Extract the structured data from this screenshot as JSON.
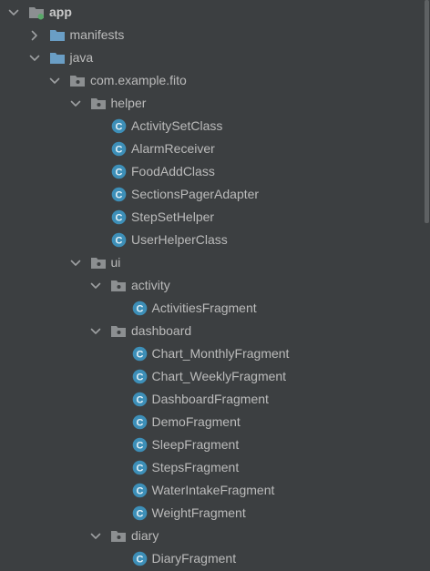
{
  "colors": {
    "background": "#3c3f41",
    "text": "#bbbbbb",
    "folder": "#6a9ec5",
    "package_folder": "#8c8f91",
    "class_icon_fill": "#3d8fb8",
    "class_icon_letter": "#e6f2f8",
    "module_dot": "#59a869"
  },
  "tree": [
    {
      "label": "app",
      "icon": "module-folder-icon",
      "chevron": "down",
      "depth": 0,
      "bold": true
    },
    {
      "label": "manifests",
      "icon": "folder-icon",
      "chevron": "right",
      "depth": 1
    },
    {
      "label": "java",
      "icon": "folder-icon",
      "chevron": "down",
      "depth": 1
    },
    {
      "label": "com.example.fito",
      "icon": "package-icon",
      "chevron": "down",
      "depth": 2
    },
    {
      "label": "helper",
      "icon": "package-icon",
      "chevron": "down",
      "depth": 3
    },
    {
      "label": "ActivitySetClass",
      "icon": "class-icon",
      "chevron": "none",
      "depth": 4
    },
    {
      "label": "AlarmReceiver",
      "icon": "class-icon",
      "chevron": "none",
      "depth": 4
    },
    {
      "label": "FoodAddClass",
      "icon": "class-icon",
      "chevron": "none",
      "depth": 4
    },
    {
      "label": "SectionsPagerAdapter",
      "icon": "class-icon",
      "chevron": "none",
      "depth": 4
    },
    {
      "label": "StepSetHelper",
      "icon": "class-icon",
      "chevron": "none",
      "depth": 4
    },
    {
      "label": "UserHelperClass",
      "icon": "class-icon",
      "chevron": "none",
      "depth": 4
    },
    {
      "label": "ui",
      "icon": "package-icon",
      "chevron": "down",
      "depth": 3
    },
    {
      "label": "activity",
      "icon": "package-icon",
      "chevron": "down",
      "depth": 4
    },
    {
      "label": "ActivitiesFragment",
      "icon": "class-icon",
      "chevron": "none",
      "depth": 5
    },
    {
      "label": "dashboard",
      "icon": "package-icon",
      "chevron": "down",
      "depth": 4
    },
    {
      "label": "Chart_MonthlyFragment",
      "icon": "class-icon",
      "chevron": "none",
      "depth": 5
    },
    {
      "label": "Chart_WeeklyFragment",
      "icon": "class-icon",
      "chevron": "none",
      "depth": 5
    },
    {
      "label": "DashboardFragment",
      "icon": "class-icon",
      "chevron": "none",
      "depth": 5
    },
    {
      "label": "DemoFragment",
      "icon": "class-icon",
      "chevron": "none",
      "depth": 5
    },
    {
      "label": "SleepFragment",
      "icon": "class-icon",
      "chevron": "none",
      "depth": 5
    },
    {
      "label": "StepsFragment",
      "icon": "class-icon",
      "chevron": "none",
      "depth": 5
    },
    {
      "label": "WaterIntakeFragment",
      "icon": "class-icon",
      "chevron": "none",
      "depth": 5
    },
    {
      "label": "WeightFragment",
      "icon": "class-icon",
      "chevron": "none",
      "depth": 5
    },
    {
      "label": "diary",
      "icon": "package-icon",
      "chevron": "down",
      "depth": 4
    },
    {
      "label": "DiaryFragment",
      "icon": "class-icon",
      "chevron": "none",
      "depth": 5
    }
  ]
}
